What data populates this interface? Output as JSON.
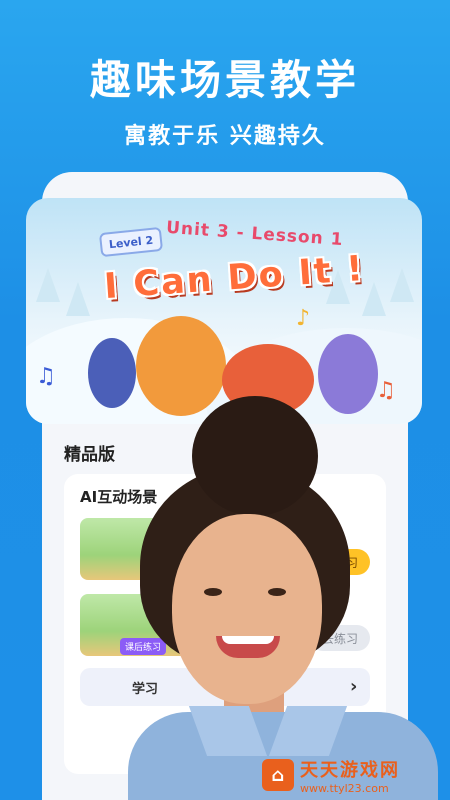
{
  "headline": "趣味场景教学",
  "subline": "寓教于乐  兴趣持久",
  "hero": {
    "level_badge": "Level 2",
    "unit_title": "Unit 3 - Lesson 1",
    "lesson_title": "I Can Do It !"
  },
  "section": {
    "title": "精品版",
    "card_title": "AI互动场景",
    "learn_button": "去学习",
    "practice_button": "去练习",
    "homework_tag": "课后练习",
    "report_label": "学习"
  },
  "watermark": {
    "name": "天天游戏网",
    "url": "www.ttyl23.com"
  }
}
